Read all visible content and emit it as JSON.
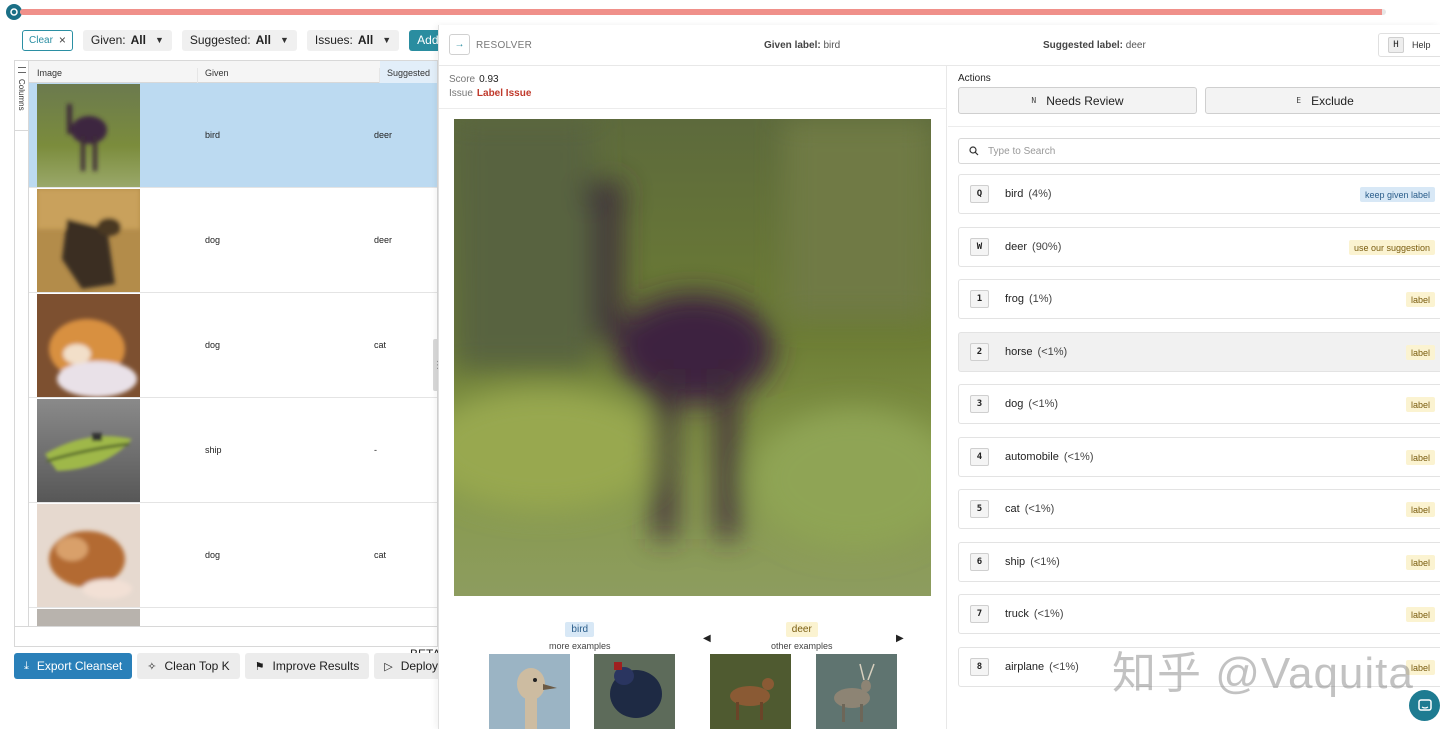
{
  "progress": {
    "fraction": 0.997
  },
  "filters": {
    "clear_label": "Clear",
    "given_label": "Given:",
    "given_value": "All",
    "suggested_label": "Suggested:",
    "suggested_value": "All",
    "issues_label": "Issues:",
    "issues_value": "All",
    "add_label": "Add New Filter"
  },
  "table": {
    "columns_tab": "Columns",
    "headers": {
      "image": "Image",
      "given": "Given",
      "suggested": "Suggested"
    },
    "rows": [
      {
        "given": "bird",
        "suggested": "deer"
      },
      {
        "given": "dog",
        "suggested": "deer"
      },
      {
        "given": "dog",
        "suggested": "cat"
      },
      {
        "given": "ship",
        "suggested": "-"
      },
      {
        "given": "dog",
        "suggested": "cat"
      }
    ]
  },
  "bottom": {
    "export": "Export Cleanset",
    "clean_top_k": "Clean Top K",
    "improve": "Improve Results",
    "deploy": "Deploy Model",
    "beta": "BETA"
  },
  "resolver": {
    "title": "RESOLVER",
    "given_key": "Given label:",
    "given_val": "bird",
    "sugg_key": "Suggested label:",
    "sugg_val": "deer",
    "help_key": "H",
    "help_label": "Help",
    "score_key": "Score",
    "score_val": "0.93",
    "issue_key": "Issue",
    "issue_val": "Label Issue",
    "examples_left_label": "bird",
    "examples_left_sub": "more examples",
    "examples_right_label": "deer",
    "examples_right_sub": "other examples",
    "actions_label": "Actions",
    "needs_review_key": "N",
    "needs_review": "Needs Review",
    "exclude_key": "E",
    "exclude": "Exclude",
    "search_placeholder": "Type to Search",
    "labels": [
      {
        "key": "Q",
        "name": "bird",
        "pct": "(4%)",
        "tag": "keep given label"
      },
      {
        "key": "W",
        "name": "deer",
        "pct": "(90%)",
        "tag": "use our suggestion"
      },
      {
        "key": "1",
        "name": "frog",
        "pct": "(1%)",
        "tag": "label"
      },
      {
        "key": "2",
        "name": "horse",
        "pct": "(<1%)",
        "tag": "label"
      },
      {
        "key": "3",
        "name": "dog",
        "pct": "(<1%)",
        "tag": "label"
      },
      {
        "key": "4",
        "name": "automobile",
        "pct": "(<1%)",
        "tag": "label"
      },
      {
        "key": "5",
        "name": "cat",
        "pct": "(<1%)",
        "tag": "label"
      },
      {
        "key": "6",
        "name": "ship",
        "pct": "(<1%)",
        "tag": "label"
      },
      {
        "key": "7",
        "name": "truck",
        "pct": "(<1%)",
        "tag": "label"
      },
      {
        "key": "8",
        "name": "airplane",
        "pct": "(<1%)",
        "tag": "label"
      }
    ]
  },
  "watermark": "知乎 @Vaquita",
  "colors": {
    "accent": "#2a8da0",
    "progress": "#f0908a",
    "selected_row": "#bcdaf1",
    "issue": "#c0392b"
  }
}
